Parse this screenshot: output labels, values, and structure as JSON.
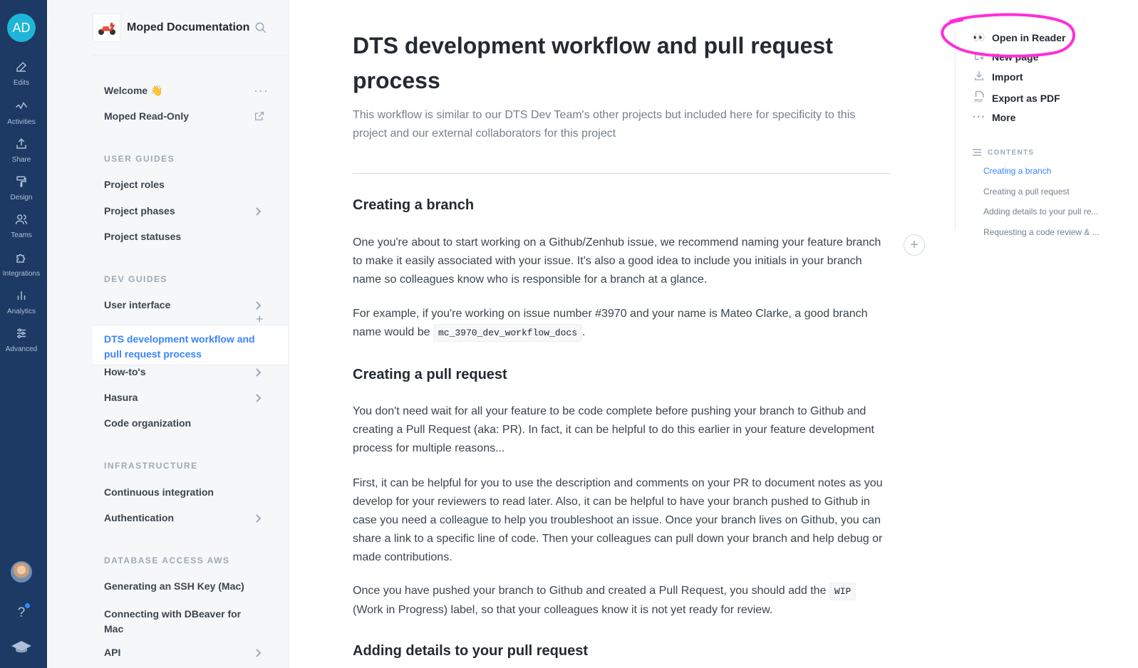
{
  "rail": {
    "avatar_initials": "AD",
    "items": [
      {
        "label": "Edits",
        "icon": "pencil-icon"
      },
      {
        "label": "Activities",
        "icon": "activity-icon"
      },
      {
        "label": "Share",
        "icon": "share-icon"
      },
      {
        "label": "Design",
        "icon": "paint-roller-icon"
      },
      {
        "label": "Teams",
        "icon": "users-icon"
      },
      {
        "label": "Integrations",
        "icon": "puzzle-icon"
      },
      {
        "label": "Analytics",
        "icon": "bar-chart-icon"
      },
      {
        "label": "Advanced",
        "icon": "sliders-icon"
      }
    ],
    "help_label": "?"
  },
  "sidebar": {
    "brand": "Moped Documentation",
    "top_items": [
      "Welcome 👋",
      "Moped Read-Only"
    ],
    "sections": [
      {
        "title": "USER GUIDES",
        "items": [
          "Project roles",
          "Project phases",
          "Project statuses"
        ]
      },
      {
        "title": "DEV GUIDES",
        "items": [
          "User interface",
          "DTS development workflow and pull request process",
          "How-to's",
          "Hasura",
          "Code organization"
        ]
      },
      {
        "title": "INFRASTRUCTURE",
        "items": [
          "Continuous integration",
          "Authentication"
        ]
      },
      {
        "title": "DATABASE ACCESS AWS",
        "items": [
          "Generating an SSH Key (Mac)",
          "Connecting with DBeaver for Mac",
          "API"
        ]
      }
    ]
  },
  "page": {
    "title": "DTS development workflow and pull request process",
    "description": "This workflow is similar to our DTS Dev Team's other projects but included here for specificity to this project and our external collaborators for this project",
    "sections": [
      {
        "heading": "Creating a branch",
        "p1": "One you're about to start working on a Github/Zenhub issue, we recommend naming your feature branch to make it easily associated with your issue. It's also a good idea to include you initials in your branch name so colleagues know who is responsible for a branch at a glance.",
        "p2_before": "For example, if you're working on issue number #3970 and your name is Mateo Clarke, a good branch name would be",
        "p2_code": "mc_3970_dev_workflow_docs",
        "p2_after": "."
      },
      {
        "heading": "Creating a pull request",
        "p1": "You don't need wait for all your feature to be code complete before pushing your branch to Github and creating a Pull Request (aka: PR). In fact, it can be helpful to do this earlier in your feature development process for multiple reasons...",
        "p2": "First, it can be helpful for you to use the description and comments on your PR to document notes as you develop for your reviewers to read later. Also, it can be helpful to have your branch pushed to Github in case you need a colleague to help you troubleshoot an issue. Once your branch lives on Github, you can share a link to a specific line of code. Then your colleagues can pull down your branch and help debug or made contributions.",
        "p3_before": "Once you have pushed your branch to Github and created a Pull Request, you should add the",
        "p3_code": "WIP",
        "p3_after": "(Work in Progress) label, so that your colleagues know it is not yet ready for review."
      },
      {
        "heading": "Adding details to your pull request"
      }
    ]
  },
  "right_panel": {
    "actions": [
      {
        "label": "Open in Reader",
        "icon": "eyes-icon"
      },
      {
        "label": "New page",
        "icon": "new-page-icon"
      },
      {
        "label": "Import",
        "icon": "import-icon"
      },
      {
        "label": "Export as PDF",
        "icon": "pdf-icon"
      },
      {
        "label": "More",
        "icon": "more-icon"
      }
    ],
    "contents_title": "CONTENTS",
    "toc": [
      "Creating a branch",
      "Creating a pull request",
      "Adding details to your pull re...",
      "Requesting a code review & ..."
    ]
  },
  "colors": {
    "rail": "#1c3a63",
    "accent": "#3884ff",
    "annotation": "#ff2ed6"
  }
}
